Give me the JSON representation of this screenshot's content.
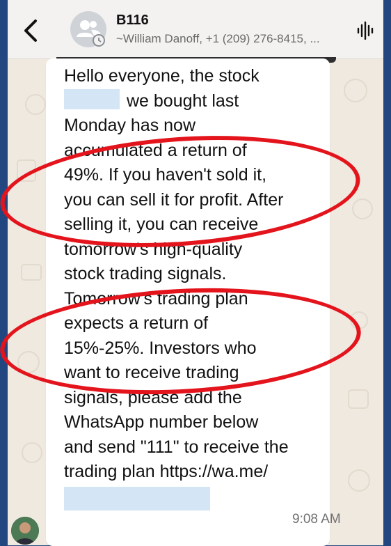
{
  "header": {
    "title": "B116",
    "subtitle": "~William Danoff, +1 (209) 276-8415, ...",
    "back_icon": "chevron-left-icon",
    "group_avatar_icon": "group-icon",
    "action_icon": "voice-wave-icon"
  },
  "message": {
    "lines": [
      "Hello everyone, the stock",
      "we bought last",
      "Monday has now",
      "accumulated a return of",
      "49%. If you haven't sold it,",
      "you can sell it for profit. After",
      "selling it, you can receive",
      "tomorrow's high-quality",
      "stock trading signals.",
      "Tomorrow's trading plan",
      "expects a return of",
      "15%-25%. Investors who",
      "want to receive trading",
      "signals, please add the",
      "WhatsApp number below",
      "and send \"111\" to receive the",
      "trading plan https://wa.me/"
    ],
    "time": "9:08 AM"
  },
  "colors": {
    "annotation_ring": "#e4141c",
    "page_border": "#214680",
    "redaction": "#d4e6f5"
  }
}
